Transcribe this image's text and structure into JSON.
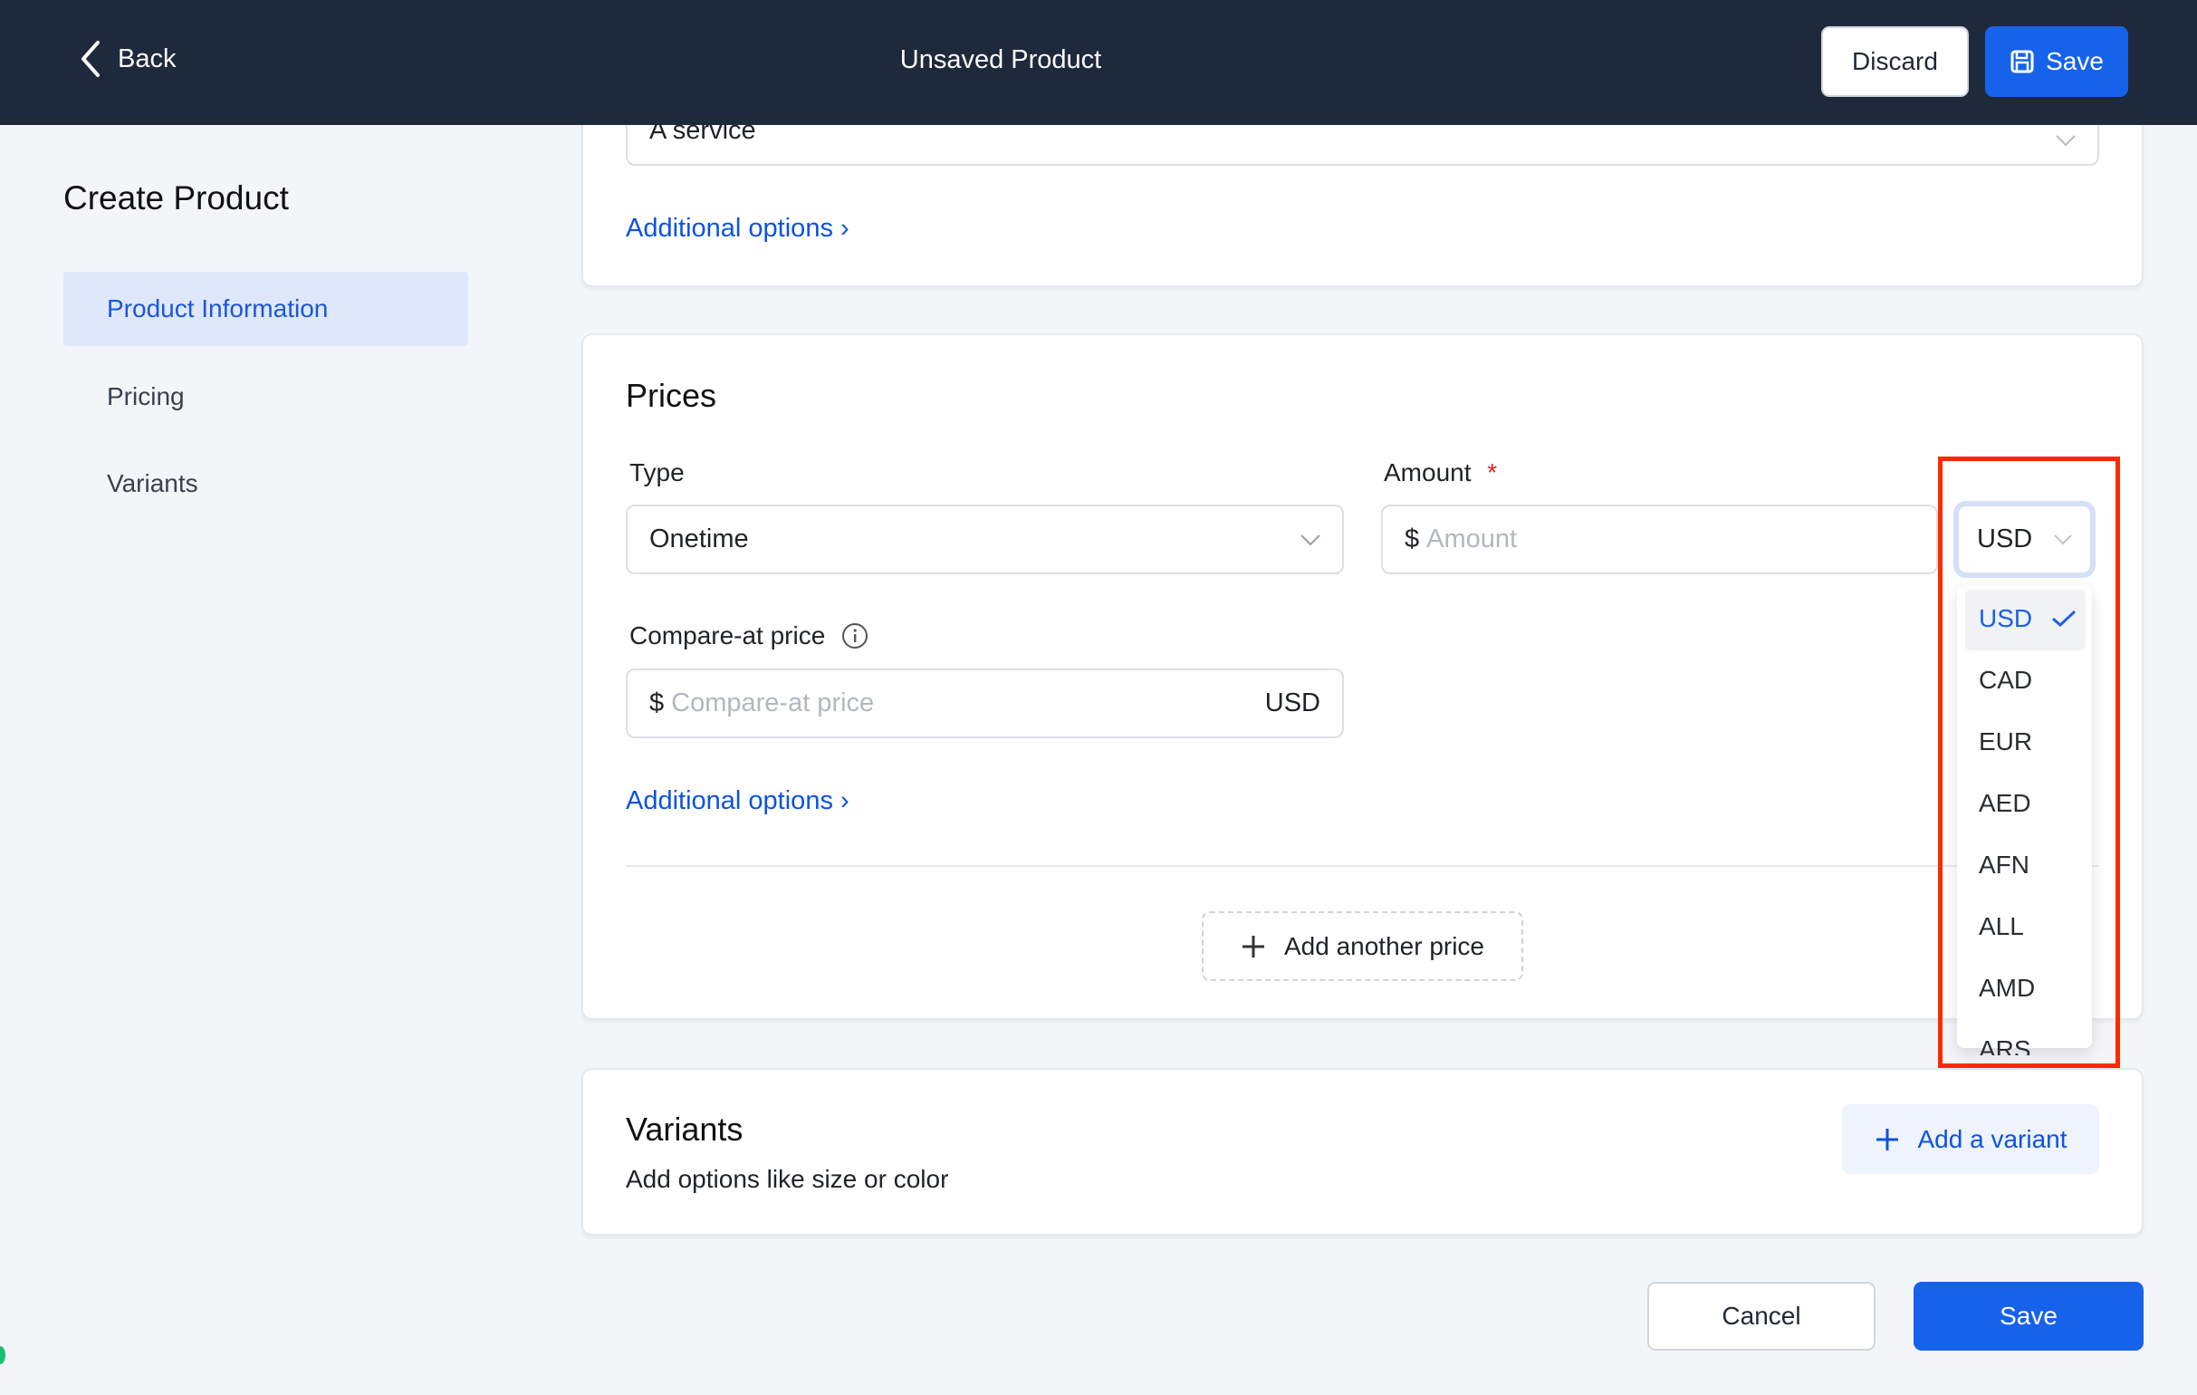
{
  "header": {
    "back_label": "Back",
    "title": "Unsaved Product",
    "discard_label": "Discard",
    "save_label": "Save"
  },
  "sidebar": {
    "title": "Create Product",
    "items": [
      {
        "label": "Product Information",
        "active": true
      },
      {
        "label": "Pricing"
      },
      {
        "label": "Variants"
      }
    ]
  },
  "product_card": {
    "product_type_value": "A service",
    "additional_options": "Additional options"
  },
  "prices": {
    "title": "Prices",
    "type_label": "Type",
    "type_value": "Onetime",
    "amount_label": "Amount",
    "required_mark": "*",
    "amount_prefix": "$",
    "amount_placeholder": "Amount",
    "currency_value": "USD",
    "compare_label": "Compare-at price",
    "compare_prefix": "$",
    "compare_placeholder": "Compare-at price",
    "compare_currency": "USD",
    "additional_options": "Additional options",
    "add_price": "Add another price"
  },
  "currency_dropdown": {
    "options": [
      "USD",
      "CAD",
      "EUR",
      "AED",
      "AFN",
      "ALL",
      "AMD",
      "ARS"
    ],
    "selected": "USD"
  },
  "variants": {
    "title": "Variants",
    "subtitle": "Add options like size or color",
    "add_label": "Add a variant"
  },
  "footer": {
    "cancel_label": "Cancel",
    "save_label": "Save"
  },
  "colors": {
    "header_bg": "#1e293b",
    "accent": "#1762ea",
    "highlight": "#ff2a00"
  }
}
